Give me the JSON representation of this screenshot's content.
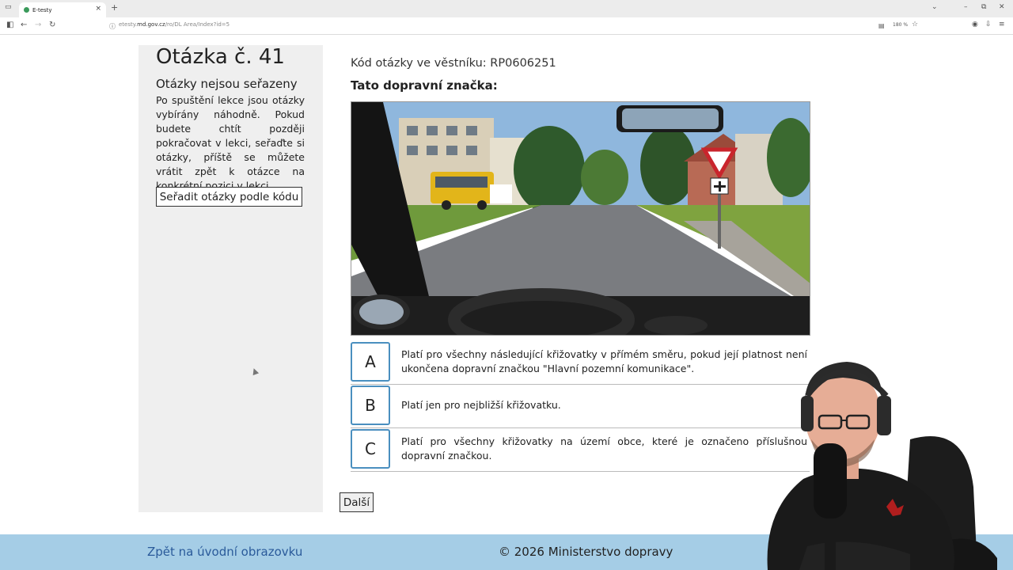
{
  "browser": {
    "tab_title": "E-testy",
    "tab_close": "×",
    "new_tab": "+",
    "url_prefix": "etesty.",
    "url_domain": "md.gov.cz",
    "url_path": "/ro/DL Area/Index?id=5",
    "zoom": "180 %"
  },
  "sidebar": {
    "question_title": "Otázka č. 41",
    "subtitle": "Otázky nejsou seřazeny",
    "text": "Po spuštění lekce jsou otázky vybírány náhodně. Pokud budete chtít později pokračovat v lekci, seřaďte si otázky, příště se můžete vrátit zpět k otázce na konkrétní pozici v lekci.",
    "sort_button": "Seřadit otázky podle kódu"
  },
  "main": {
    "code_line": "Kód otázky ve věstníku: RP0606251",
    "prompt": "Tato dopravní značka:",
    "answers": [
      {
        "letter": "A",
        "text": "Platí pro všechny následující křižovatky v přímém směru, pokud její platnost není ukončena dopravní značkou \"Hlavní pozemní komunikace\"."
      },
      {
        "letter": "B",
        "text": "Platí jen pro nejbližší křižovatku."
      },
      {
        "letter": "C",
        "text": "Platí pro všechny křižovatky na území obce, které je označeno příslušnou dopravní značkou."
      }
    ],
    "next_button": "Další"
  },
  "footer": {
    "back_link": "Zpět na úvodní obrazovku",
    "copyright": "© 2026 Ministerstvo dopravy"
  },
  "colors": {
    "accent_border": "#4a8fbf",
    "footer_bg": "#a5cde6",
    "sidebar_bg": "#efefef"
  }
}
